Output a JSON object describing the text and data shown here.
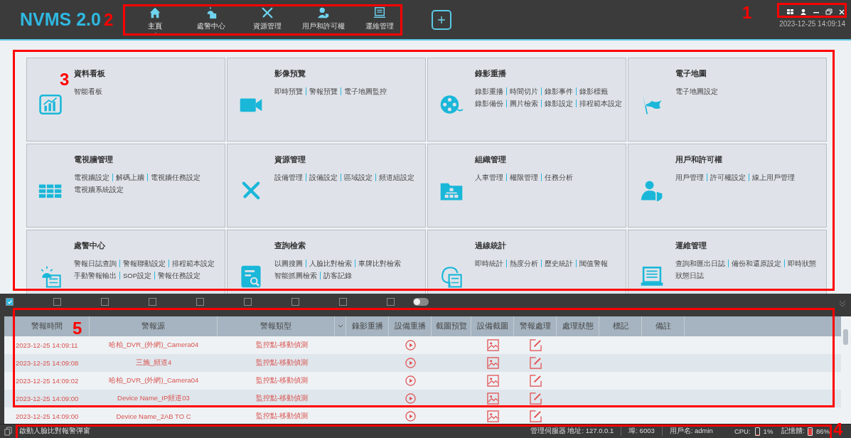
{
  "app": {
    "logo": "NVMS 2.0",
    "time": "2023-12-25 14:09:14"
  },
  "nav": [
    {
      "label": "主頁",
      "selected": true
    },
    {
      "label": "處警中心",
      "selected": false
    },
    {
      "label": "資源管理",
      "selected": false
    },
    {
      "label": "用戶和許可權",
      "selected": false
    },
    {
      "label": "運維管理",
      "selected": false
    }
  ],
  "tiles": [
    {
      "title": "資料看板",
      "lines": [
        [
          "智能看板"
        ]
      ]
    },
    {
      "title": "影像預覽",
      "lines": [
        [
          "即時預覽",
          "警報預覽",
          "電子地圖監控"
        ]
      ]
    },
    {
      "title": "錄影重播",
      "lines": [
        [
          "錄影重播",
          "時間切片",
          "錄影事件",
          "錄影標籤"
        ],
        [
          "錄影備份",
          "圖片檢索",
          "錄影設定",
          "排程範本設定"
        ]
      ]
    },
    {
      "title": "電子地圖",
      "lines": [
        [
          "電子地圖設定"
        ]
      ]
    },
    {
      "title": "電視牆管理",
      "lines": [
        [
          "電視牆設定",
          "解碼上牆",
          "電視牆任務設定"
        ],
        [
          "電視牆系統設定"
        ]
      ]
    },
    {
      "title": "資源管理",
      "lines": [
        [
          "設備管理",
          "設備設定",
          "區域設定",
          "頻道組設定"
        ]
      ]
    },
    {
      "title": "組織管理",
      "lines": [
        [
          "人車管理",
          "權限管理",
          "任務分析"
        ]
      ]
    },
    {
      "title": "用戶和許可權",
      "lines": [
        [
          "用戶管理",
          "許可權設定",
          "線上用戶管理"
        ]
      ]
    },
    {
      "title": "處警中心",
      "lines": [
        [
          "警報日誌查詢",
          "警報聯動設定",
          "排程範本設定"
        ],
        [
          "手動警報輸出",
          "SOP設定",
          "警報任務設定"
        ]
      ]
    },
    {
      "title": "查詢檢索",
      "lines": [
        [
          "以圖搜圖",
          "人臉比對檢索",
          "車牌比對檢索"
        ],
        [
          "智能抓圖檢索",
          "訪客記錄"
        ]
      ]
    },
    {
      "title": "過線統計",
      "lines": [
        [
          "即時統計",
          "熱度分析",
          "歷史統計",
          "閾值警報"
        ]
      ]
    },
    {
      "title": "運維管理",
      "lines": [
        [
          "查詢和匯出日誌",
          "備份和還原設定",
          "即時狀態"
        ],
        [
          "狀態日誌"
        ]
      ]
    }
  ],
  "filters": [
    {
      "checked": true
    },
    {
      "checked": false
    },
    {
      "checked": false
    },
    {
      "checked": false
    },
    {
      "checked": false
    },
    {
      "checked": false
    },
    {
      "checked": false
    },
    {
      "checked": false
    },
    {
      "checked": false
    }
  ],
  "filter_toggle": {
    "on": false
  },
  "table": {
    "columns": [
      "警報時間",
      "警報源",
      "警報類型",
      "",
      "錄影重播",
      "設備重播",
      "截圖預覽",
      "設備截圖",
      "警報處理",
      "處理狀態",
      "標記",
      "備註"
    ],
    "rows": [
      {
        "time": "2023-12-25 14:09:11",
        "source": "哈柏_DVR_(外網)_Camera04",
        "type": "監控點-移動偵測"
      },
      {
        "time": "2023-12-25 14:09:08",
        "source": "三施_頻道4",
        "type": "監控點-移動偵測"
      },
      {
        "time": "2023-12-25 14:09:02",
        "source": "哈柏_DVR_(外網)_Camera04",
        "type": "監控點-移動偵測"
      },
      {
        "time": "2023-12-25 14:09:00",
        "source": "Device Name_IP頻道03",
        "type": "監控點-移動偵測"
      },
      {
        "time": "2023-12-25 14:09:00",
        "source": "Device Name_2AB TO C",
        "type": "監控點-移動偵測"
      }
    ]
  },
  "status_bar": {
    "popup_label": "啟動人臉比對報警彈窗",
    "server": "管理伺服器 地址: 127.0.0.1",
    "port": "埠: 6003",
    "user": "用戶名: admin",
    "cpu_label": "CPU:",
    "cpu": {
      "level": 0.01
    },
    "cpu_value": "1%",
    "memory_label": "記憶體:",
    "memory": {
      "level": 0.86
    },
    "memory_value": "86%"
  },
  "annotations": [
    {
      "label": "1",
      "kind": "window-controls"
    },
    {
      "label": "2",
      "kind": "nav"
    },
    {
      "label": "3",
      "kind": "tiles"
    },
    {
      "label": "5",
      "kind": "table"
    },
    {
      "label": "4",
      "kind": "status"
    }
  ]
}
